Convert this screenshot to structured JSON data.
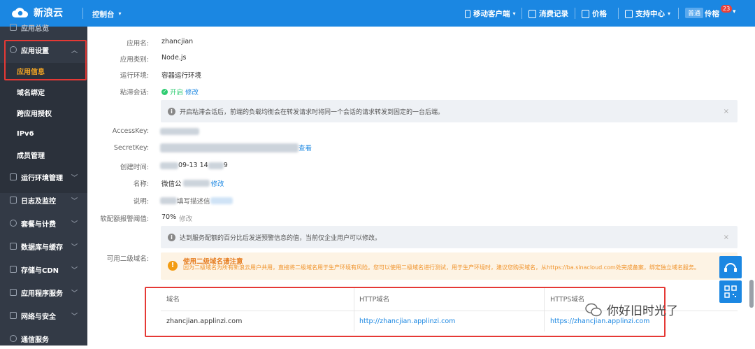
{
  "topbar": {
    "logo_text": "新浪云",
    "console_label": "控制台",
    "nav": [
      {
        "label": "移动客户端",
        "icon": "mobile-icon"
      },
      {
        "label": "消费记录",
        "icon": "receipt-icon"
      },
      {
        "label": "价格",
        "icon": "price-icon"
      },
      {
        "label": "支持中心",
        "icon": "support-icon"
      }
    ],
    "user_badge": "普通",
    "user_name": "伶榕",
    "notif_count": "23"
  },
  "sidebar": {
    "top_partial": "应用总览",
    "group": "应用设置",
    "sub_items": [
      "应用信息",
      "域名绑定",
      "跨应用授权",
      "IPv6",
      "成员管理"
    ],
    "active_sub": "应用信息",
    "sections": [
      "运行环境管理",
      "日志及监控",
      "套餐与计费",
      "数据库与缓存",
      "存储与CDN",
      "应用程序服务",
      "网络与安全",
      "通信服务"
    ]
  },
  "form": {
    "app_name_label": "应用名:",
    "app_name": "zhancjian",
    "app_type_label": "应用类别:",
    "app_type": "Node.js",
    "runtime_label": "运行环境:",
    "runtime": "容器运行环境",
    "sticky_label": "粘滞会话:",
    "sticky_status": "开启",
    "sticky_edit": "修改",
    "sticky_info": "开启粘滞会话后，前端的负载均衡会在转发请求时将同一个会话的请求转发到固定的一台后端。",
    "accesskey_label": "AccessKey:",
    "secretkey_label": "SecretKey:",
    "secretkey_view": "查看",
    "created_label": "创建时间:",
    "created_value": "09-13 14",
    "created_value_tail": "9",
    "name_label": "名称:",
    "name_value": "微信公",
    "name_edit": "修改",
    "desc_label": "说明:",
    "desc_value": "填写描述信",
    "quota_label": "软配额报警阈值:",
    "quota_value": "70%",
    "quota_edit": "修改",
    "quota_info": "达到服务配额的百分比后发送预警信息的值，当前仅企业用户可以修改。",
    "subdomain_label": "可用二级域名:",
    "warn_title": "使用二级域名请注意",
    "warn_text": "因为二级域名为所有新浪云用户共用，直接将二级域名用于生产环境有风险。您可以使用二级域名进行测试，用于生产环境时，建议您购买域名，从https://ba.sinacloud.com处完成备案，绑定独立域名服务。"
  },
  "domain_table": {
    "headers": [
      "域名",
      "HTTP域名",
      "HTTPS域名"
    ],
    "rows": [
      [
        "zhancjian.applinzi.com",
        "http://zhancjian.applinzi.com",
        "https://zhancjian.applinzi.com"
      ]
    ]
  },
  "watermark": "你好旧时光了"
}
